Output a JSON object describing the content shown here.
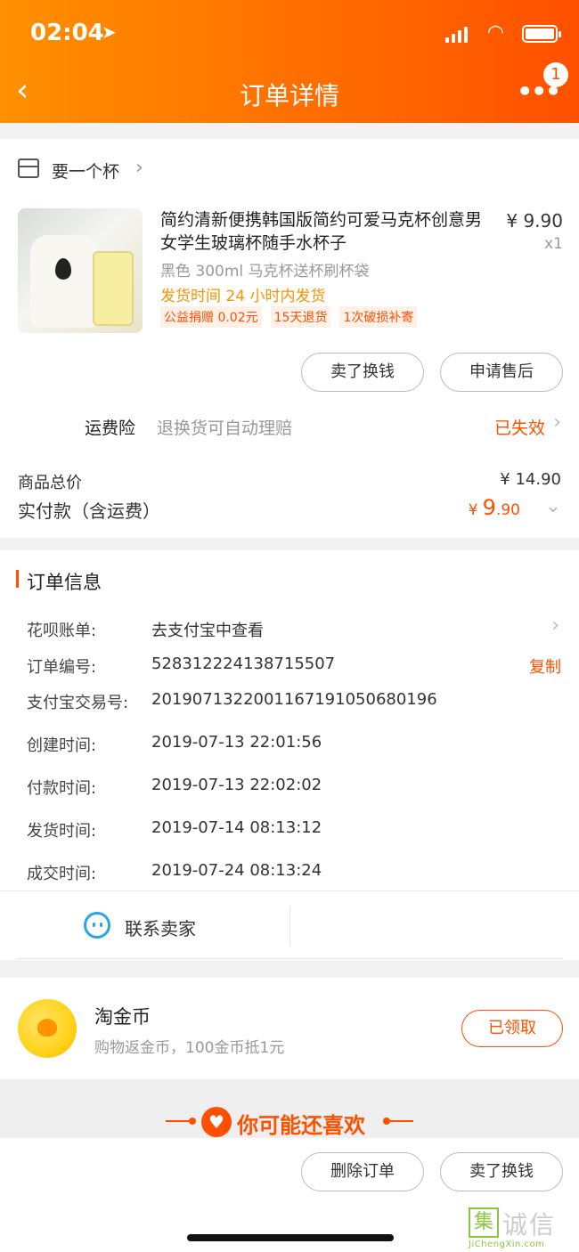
{
  "status_bar": {
    "time": "02:04"
  },
  "header": {
    "title": "订单详情",
    "badge_count": "1"
  },
  "shop": {
    "name": "要一个杯"
  },
  "product": {
    "title": "简约清新便携韩国版简约可爱马克杯创意男女学生玻璃杯随手水杯子",
    "price": "¥ 9.90",
    "quantity": "x1",
    "sku": "黑色 300ml 马克杯送杯刷杯袋",
    "shipping": "发货时间  24 小时内发货",
    "tags": [
      "公益捐赠 0.02元",
      "15天退货",
      "1次破损补寄"
    ]
  },
  "actions": {
    "sell_label": "卖了换钱",
    "aftersale_label": "申请售后"
  },
  "insurance": {
    "label": "运费险",
    "desc": "退换货可自动理赔",
    "status": "已失效"
  },
  "totals": {
    "goods_label": "商品总价",
    "goods_value": "¥ 14.90",
    "paid_label": "实付款（含运费）",
    "paid_currency": "¥",
    "paid_int": "9",
    "paid_dec": ".90"
  },
  "order_info": {
    "title": "订单信息",
    "huabei_label": "花呗账单:",
    "huabei_value": "去支付宝中查看",
    "order_no_label": "订单编号:",
    "order_no_value": "528312224138715507",
    "copy_label": "复制",
    "alipay_label": "支付宝交易号:",
    "alipay_value": "2019071322001167191050680196",
    "created_label": "创建时间:",
    "created_value": "2019-07-13 22:01:56",
    "paid_label": "付款时间:",
    "paid_value": "2019-07-13 22:02:02",
    "shipped_label": "发货时间:",
    "shipped_value": "2019-07-14 08:13:12",
    "done_label": "成交时间:",
    "done_value": "2019-07-24 08:13:24"
  },
  "contact": {
    "label": "联系卖家"
  },
  "coins": {
    "title": "淘金币",
    "desc": "购物返金币，100金币抵1元",
    "button": "已领取"
  },
  "recommend": {
    "title": "你可能还喜欢"
  },
  "bottom": {
    "delete_label": "删除订单",
    "sell_label": "卖了换钱"
  },
  "watermark": {
    "box_char": "集",
    "chars": "诚信",
    "url": "JiChengXin.com"
  },
  "colors": {
    "accent": "#ff5000",
    "header_start": "#ff9000",
    "contact_blue": "#28a6e8"
  }
}
